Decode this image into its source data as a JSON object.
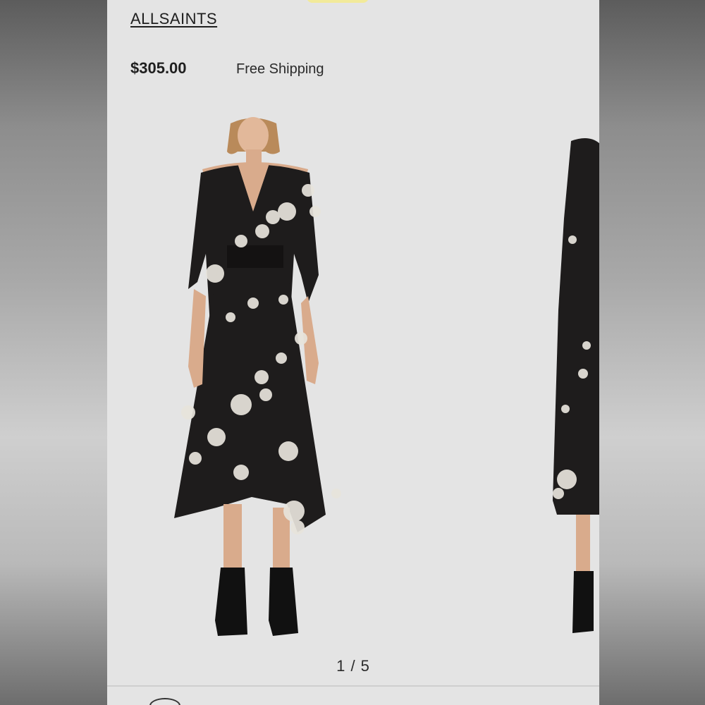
{
  "product": {
    "brand": "ALLSAINTS",
    "price": "$305.00",
    "shipping": "Free Shipping"
  },
  "gallery": {
    "current": 1,
    "total": 5,
    "counter_label": "1 / 5",
    "images": [
      "black-floral-midi-dress-front",
      "black-floral-midi-dress-side"
    ]
  },
  "colors": {
    "page_background": "#e4e4e4",
    "dress": "#1e1c1c",
    "print": "#e8e4dc"
  }
}
